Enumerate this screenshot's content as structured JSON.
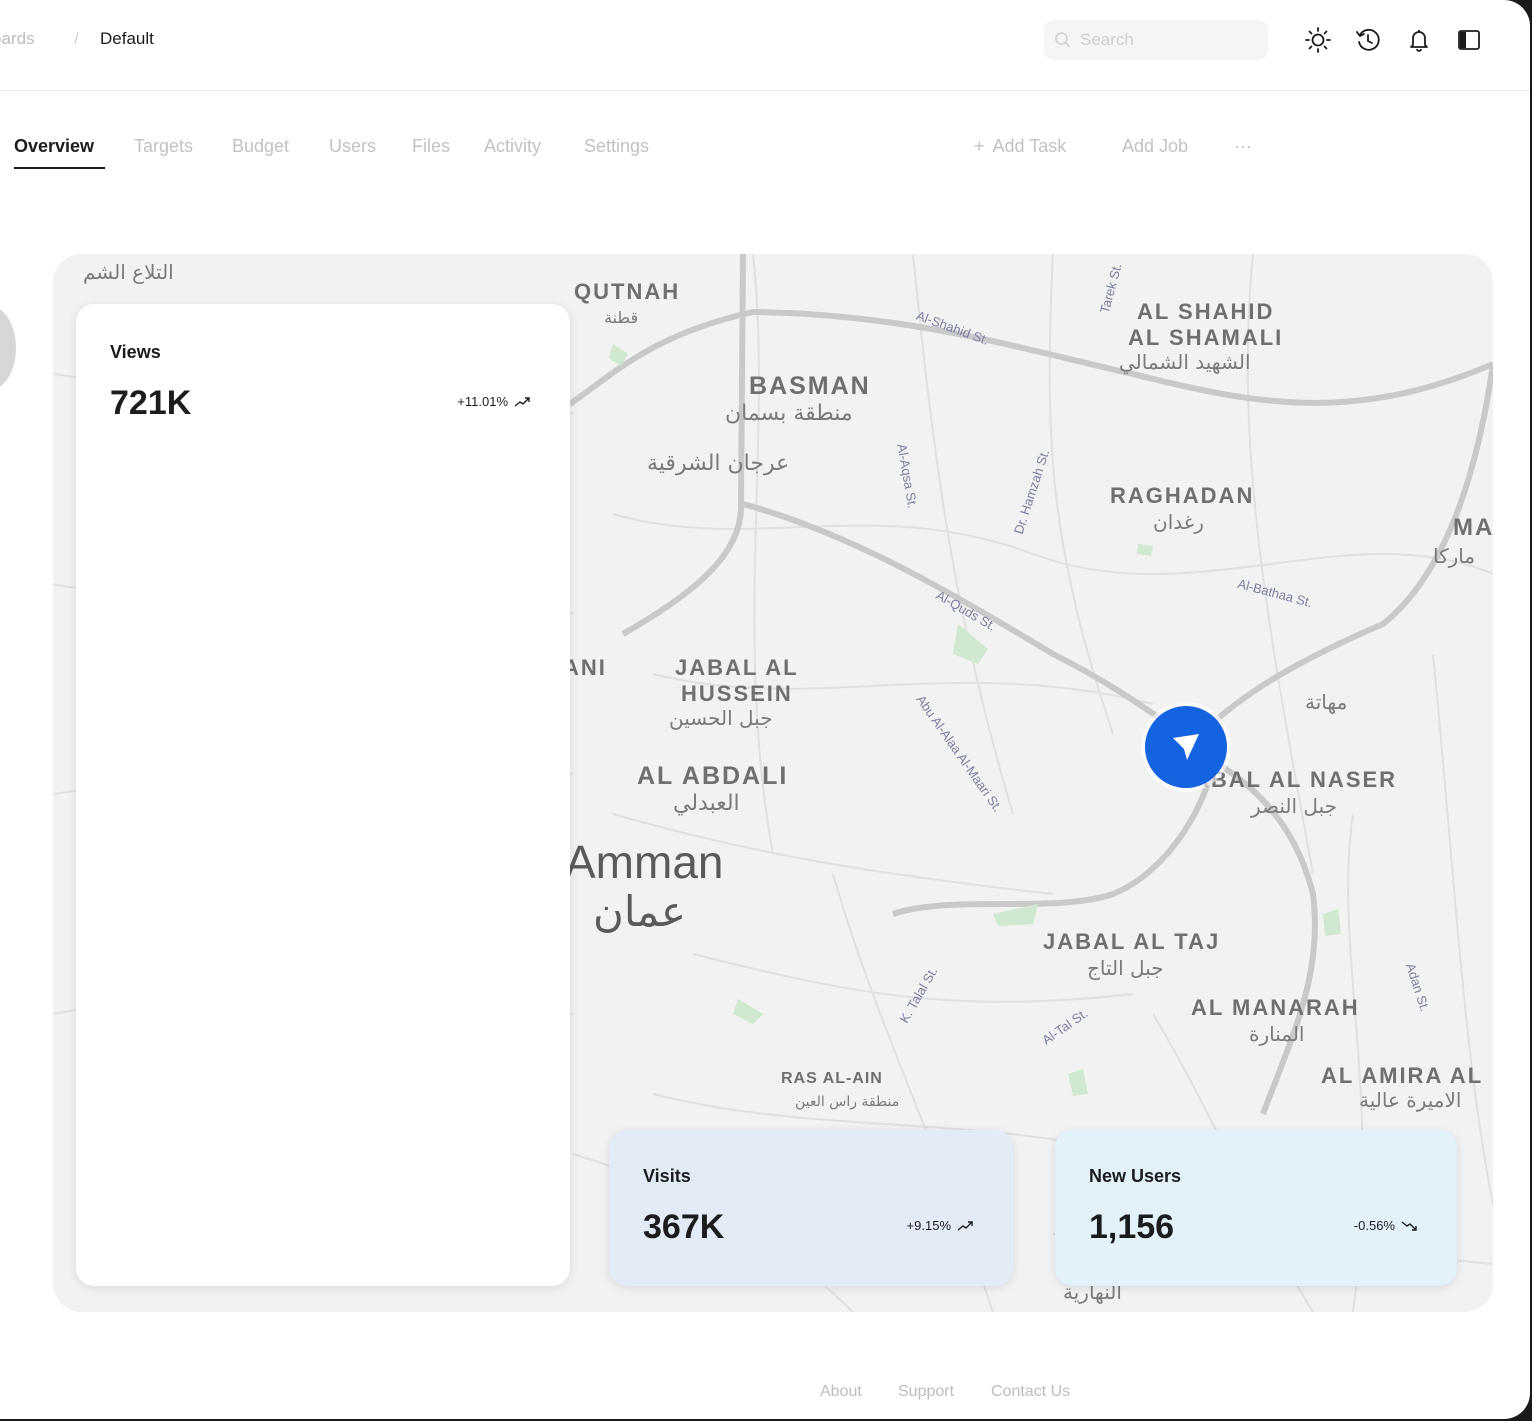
{
  "breadcrumb": {
    "previous": "oards",
    "separator": "/",
    "current": "Default"
  },
  "search": {
    "placeholder": "Search"
  },
  "header_icons": [
    "sun-icon",
    "history-icon",
    "bell-icon",
    "sidebar-toggle-icon"
  ],
  "tabs": [
    {
      "label": "Overview",
      "active": true
    },
    {
      "label": "Targets"
    },
    {
      "label": "Budget"
    },
    {
      "label": "Users"
    },
    {
      "label": "Files"
    },
    {
      "label": "Activity"
    },
    {
      "label": "Settings"
    }
  ],
  "actions": {
    "add_task": "Add Task",
    "add_job": "Add Job",
    "more": "···"
  },
  "map": {
    "labels": {
      "qutnah": "QUTNAH",
      "qutnah_ar": "قطنة",
      "basman": "BASMAN",
      "basman_ar": "منطقة بسمان",
      "arjan_ar": "عرجان الشرقية",
      "shahid1": "AL SHAHID",
      "shahid2": "AL SHAMALI",
      "shahid_ar": "الشهيد الشمالي",
      "raghadan": "RAGHADAN",
      "raghadan_ar": "رغدان",
      "marka": "MA",
      "marka_ar": "ماركا",
      "hussein1": "JABAL AL",
      "hussein2": "HUSSEIN",
      "hussein_ar": "جبل الحسين",
      "abdali": "AL ABDALI",
      "abdali_ar": "العبدلي",
      "amman": "Amman",
      "amman_ar": "عمان",
      "naser": "ABAL AL NASER",
      "naser_ar": "جبل النصر",
      "mahata_ar": "مهاتة",
      "taj": "JABAL AL TAJ",
      "taj_ar": "جبل التاج",
      "manarah": "AL MANARAH",
      "manarah_ar": "المنارة",
      "amira": "AL AMIRA AL",
      "amira_ar": "الاميرة عالية",
      "rasalain": "RAS AL-AIN",
      "rasalain_ar": "منطقة راس العين",
      "balaa_ar": "التلاع الشم",
      "nahda_ar": "النهارية",
      "ani": "ANI",
      "st_shahid": "Al-Shahid St.",
      "st_tarek": "Tarek St.",
      "st_hamzah": "Dr. Hamzah St.",
      "st_aqsa": "Al-Aqsa St.",
      "st_bathaa": "Al-Bathaa St.",
      "st_abu": "Abu Al-Alaa Al-Maari St.",
      "st_talal": "K. Talal St.",
      "st_tal": "Al-Tal St.",
      "st_adan": "Adan St.",
      "st_quds": "Al-Quds St."
    }
  },
  "cards": {
    "views": {
      "title": "Views",
      "value": "721K",
      "change": "+11.01%"
    },
    "visits": {
      "title": "Visits",
      "value": "367K",
      "change": "+9.15%"
    },
    "new_users": {
      "title": "New Users",
      "value": "1,156",
      "change": "-0.56%"
    }
  },
  "footer": {
    "about": "About",
    "support": "Support",
    "contact": "Contact Us"
  }
}
